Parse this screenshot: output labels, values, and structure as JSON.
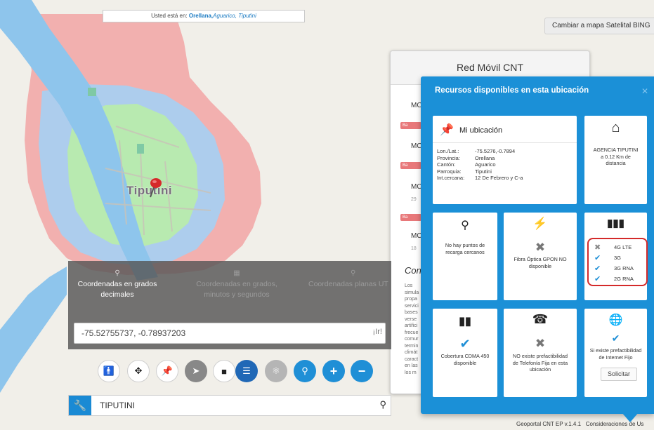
{
  "breadcrumb": {
    "prefix": "Usted está en:",
    "province": "Orellana,",
    "canton": "Aguarico,",
    "parish": "Tiputini"
  },
  "map": {
    "town_label": "Tiputini",
    "satellite_button": "Cambiar a mapa Satelital BING",
    "coverage_colors": {
      "outer": "#f2a8a8",
      "middle": "#a9cff0",
      "inner": "#b8eab0",
      "river": "#8ec5ec"
    }
  },
  "red_movil": {
    "title": "Red Móvil CNT",
    "items": [
      {
        "label": "MC",
        "tag": "Ba"
      },
      {
        "label": "MC",
        "tag": "Ba"
      },
      {
        "label": "MC",
        "sub": "29",
        "tag": "Ba"
      },
      {
        "label": "MC",
        "sub": "18"
      }
    ],
    "section_title": "Con",
    "section_text": [
      "Los",
      "simula",
      "propa",
      "servici",
      "bases",
      "verse",
      "artifici",
      "frecue",
      "comur",
      "termin",
      "climát",
      "caract",
      "en las",
      "los m"
    ]
  },
  "coordinates": {
    "tabs": [
      {
        "label": "Coordenadas en grados decimales",
        "icon": "location-pin-icon"
      },
      {
        "label": "Coordenadas en grados, minutos y segundos",
        "icon": "grid-icon"
      },
      {
        "label": "Coordenadas planas UT",
        "icon": "location-pin-icon"
      }
    ],
    "value": "-75.52755737, -0.78937203",
    "go_label": "¡Ir!"
  },
  "tools": [
    "person-icon",
    "move-icon",
    "pin-icon",
    "navigate-icon",
    "comment-icon",
    "list-icon",
    "eraser-icon",
    "zoom-icon",
    "plus-icon",
    "minus-icon"
  ],
  "search": {
    "value": "TIPUTINI"
  },
  "footer": {
    "version": "Geoportal CNT EP v.1.4.1",
    "terms": "Consideraciones de Us"
  },
  "resources": {
    "title": "Recursos disponibles en esta ubicación",
    "location": {
      "title": "Mi ubicación",
      "rows": [
        {
          "key": "Lon./Lat.:",
          "value": "-75.5276,-0.7894"
        },
        {
          "key": "Provincia:",
          "value": "Orellana"
        },
        {
          "key": "Cantón:",
          "value": "Aguarico"
        },
        {
          "key": "Parroquia:",
          "value": "Tiputini"
        },
        {
          "key": "Int.cercana:",
          "value": "12 De Febrero y C-a"
        }
      ]
    },
    "agency": {
      "line1": "AGENCIA TIPUTINI",
      "line2": "a 0.12 Km de",
      "line3": "distancia"
    },
    "recharge": {
      "line1": "No hay puntos de",
      "line2": "recarga cercanos"
    },
    "fiber": {
      "line1": "Fibra Óptica GPON NO",
      "line2": "disponible"
    },
    "networks": [
      {
        "label": "4G LTE",
        "available": false
      },
      {
        "label": "3G",
        "available": true
      },
      {
        "label": "3G RNA",
        "available": true
      },
      {
        "label": "2G RNA",
        "available": true
      }
    ],
    "cdma": {
      "line1": "Cobertura CDMA 450",
      "line2": "disponible"
    },
    "landline": {
      "line1": "NO existe prefactibilidad",
      "line2": "de Telefonía Fija en esta",
      "line3": "ubicación"
    },
    "internet": {
      "line1": "Si existe prefactibilidad",
      "line2": "de Internet Fijo",
      "button": "Solicitar"
    },
    "accent_color": "#1b90d7",
    "check_color": "#1f8fd6"
  }
}
